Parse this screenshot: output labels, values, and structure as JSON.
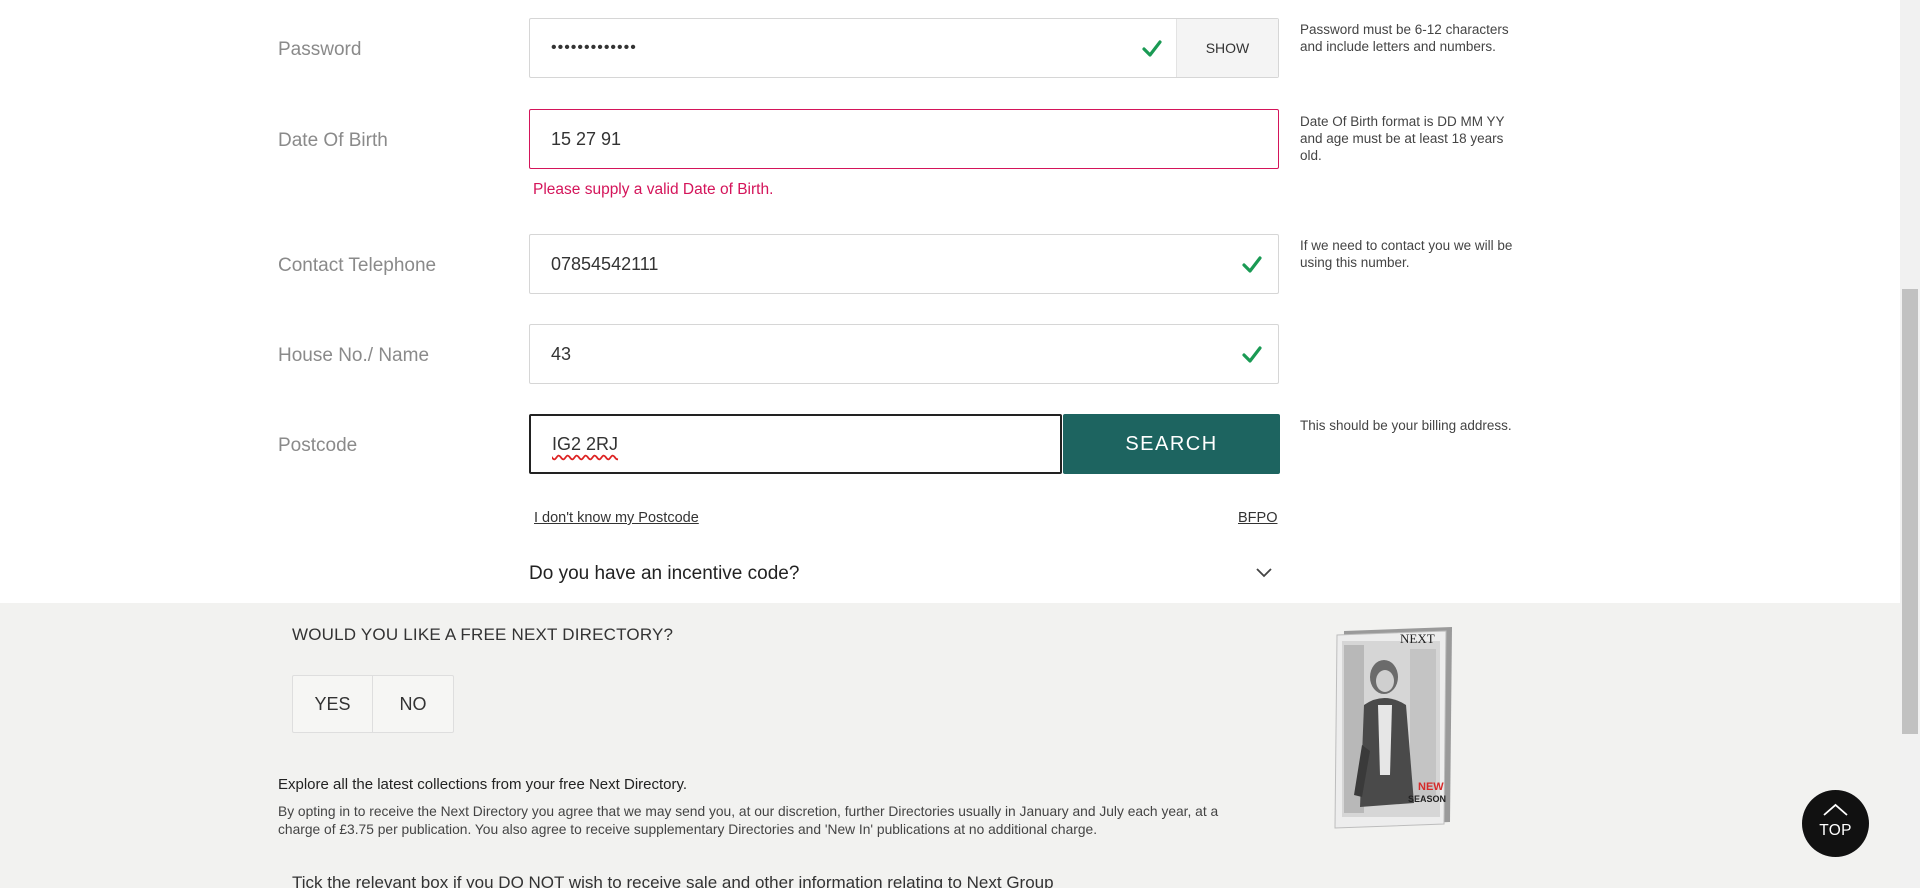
{
  "form": {
    "password": {
      "label": "Password",
      "value": "•••••••••••••",
      "show_label": "SHOW",
      "help": "Password must be 6-12 characters and include letters and numbers."
    },
    "dob": {
      "label": "Date Of Birth",
      "value": "15 27 91",
      "error": "Please supply a valid Date of Birth.",
      "help": "Date Of Birth format is DD MM YY and age must be at least 18 years old."
    },
    "telephone": {
      "label": "Contact Telephone",
      "value": "07854542111",
      "help": "If we need to contact you we will be using this number."
    },
    "house": {
      "label": "House No./ Name",
      "value": "43"
    },
    "postcode": {
      "label": "Postcode",
      "value": "IG2 2RJ",
      "search_label": "SEARCH",
      "help": "This should be your billing address."
    },
    "links": {
      "unknown_postcode": "I don't know my Postcode",
      "bfpo": "BFPO"
    },
    "incentive": {
      "label": "Do you have an incentive code?"
    }
  },
  "directory": {
    "question": "WOULD YOU LIKE A FREE NEXT DIRECTORY?",
    "yes_label": "YES",
    "no_label": "NO",
    "heading": "Explore all the latest collections from your free Next Directory.",
    "text": "By opting in to receive the Next Directory you agree that we may send you, at our discretion, further Directories usually in January and July each year, at a charge of £3.75 per publication. You also agree to receive supplementary Directories and 'New In' publications at no additional charge.",
    "catalog_brand": "NEXT",
    "catalog_new": "NEW",
    "catalog_season": "SEASON"
  },
  "bottom_text": "Tick the relevant box if you DO NOT wish to receive sale and other information relating to Next Group",
  "top_button": {
    "label": "TOP"
  },
  "colors": {
    "error": "#d4145a",
    "success": "#1a9a54",
    "search_button": "#1d6460",
    "panel": "#f2f2f0"
  },
  "icons": {
    "valid": "checkmark-icon",
    "expand": "chevron-down-icon",
    "scroll_top": "arrow-up-icon"
  }
}
